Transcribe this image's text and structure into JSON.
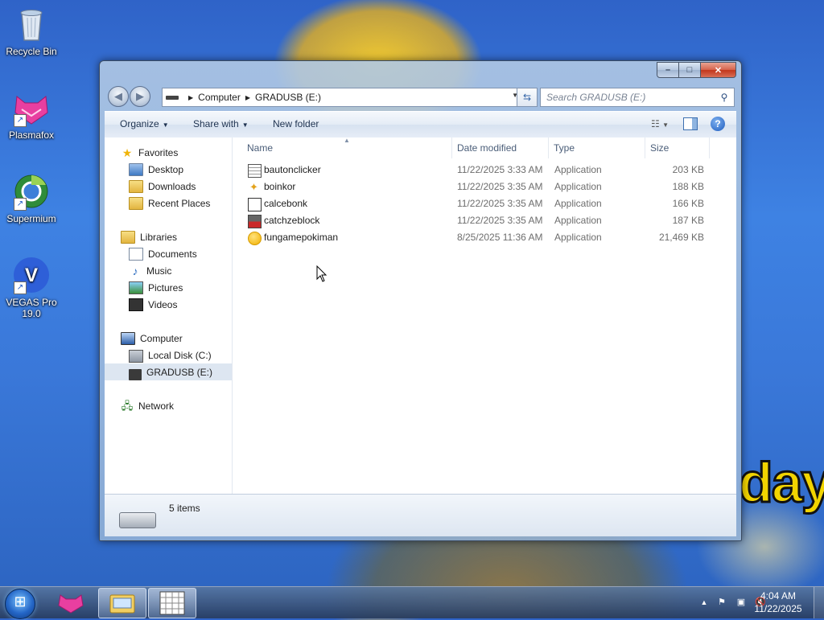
{
  "desktop": {
    "icons": [
      {
        "label": "Recycle Bin",
        "icon": "recycle-bin-icon"
      },
      {
        "label": "Plasmafox",
        "icon": "plasmafox-icon"
      },
      {
        "label": "Supermium",
        "icon": "supermium-icon"
      },
      {
        "label": "VEGAS Pro 19.0",
        "icon": "vegas-pro-icon",
        "glyph": "V"
      }
    ],
    "wallpaper_text": "day"
  },
  "window": {
    "breadcrumb": [
      "Computer",
      "GRADUSB (E:)"
    ],
    "search_placeholder": "Search GRADUSB (E:)",
    "caption_buttons": {
      "minimize": "–",
      "maximize": "□",
      "close": "✕"
    },
    "toolbar": {
      "organize": "Organize",
      "share_with": "Share with",
      "new_folder": "New folder",
      "help": "?"
    },
    "nav_pane": {
      "favorites": {
        "label": "Favorites",
        "items": [
          "Desktop",
          "Downloads",
          "Recent Places"
        ]
      },
      "libraries": {
        "label": "Libraries",
        "items": [
          "Documents",
          "Music",
          "Pictures",
          "Videos"
        ]
      },
      "computer": {
        "label": "Computer",
        "items": [
          "Local Disk (C:)",
          "GRADUSB (E:)"
        ],
        "selected": "GRADUSB (E:)"
      },
      "network": {
        "label": "Network"
      }
    },
    "columns": {
      "name": "Name",
      "date": "Date modified",
      "type": "Type",
      "size": "Size"
    },
    "files": [
      {
        "name": "bautonclicker",
        "date": "11/22/2025 3:33 AM",
        "type": "Application",
        "size": "203 KB",
        "icon": "grid-app-icon"
      },
      {
        "name": "boinkor",
        "date": "11/22/2025 3:35 AM",
        "type": "Application",
        "size": "188 KB",
        "icon": "star-app-icon"
      },
      {
        "name": "calcebonk",
        "date": "11/22/2025 3:35 AM",
        "type": "Application",
        "size": "166 KB",
        "icon": "calculator-app-icon"
      },
      {
        "name": "catchzeblock",
        "date": "11/22/2025 3:35 AM",
        "type": "Application",
        "size": "187 KB",
        "icon": "block-game-icon"
      },
      {
        "name": "fungamepokiman",
        "date": "8/25/2025 11:36 AM",
        "type": "Application",
        "size": "21,469 KB",
        "icon": "coin-app-icon"
      }
    ],
    "status": {
      "count": "5 items"
    }
  },
  "taskbar": {
    "clock_time": "4:04 AM",
    "clock_date": "11/22/2025",
    "apps": [
      "Plasmafox",
      "Windows Explorer",
      "bautonclicker"
    ]
  },
  "colors": {
    "accent": "#3a78d9",
    "selection": "#dde6f1",
    "wall_text": "#f2d400"
  }
}
